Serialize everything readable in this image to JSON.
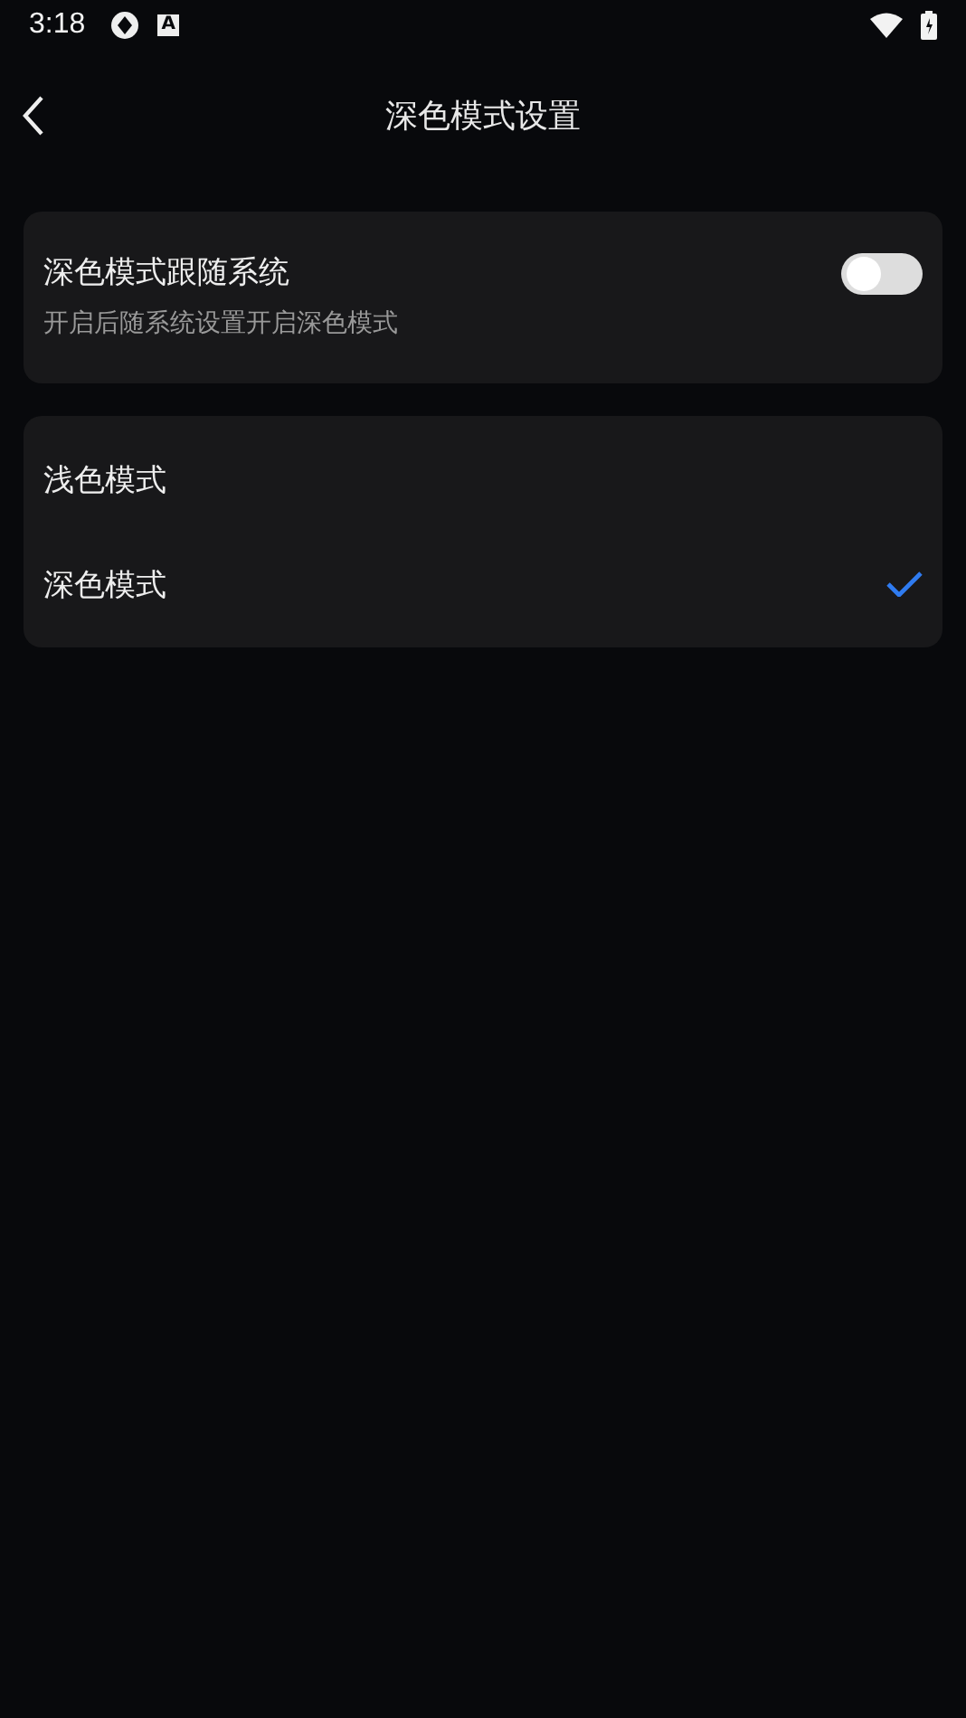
{
  "status_bar": {
    "time": "3:18",
    "badge_letter": "A"
  },
  "header": {
    "title": "深色模式设置"
  },
  "follow_system": {
    "label": "深色模式跟随系统",
    "description": "开启后随系统设置开启深色模式",
    "on": false
  },
  "modes": [
    {
      "label": "浅色模式",
      "selected": false
    },
    {
      "label": "深色模式",
      "selected": true
    }
  ]
}
